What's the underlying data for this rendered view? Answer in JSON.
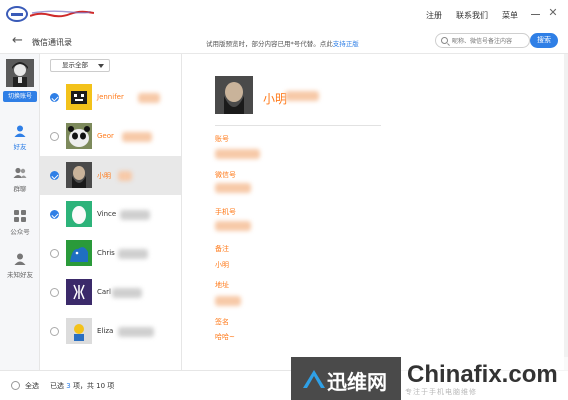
{
  "titlebar": {
    "links": [
      "注册",
      "联系我们",
      "菜单"
    ],
    "minimize_icon": "minimize-icon",
    "close_glyph": "✕"
  },
  "subheader": {
    "back_glyph": "←",
    "title": "微信通讯录",
    "notice_text": "试用版预览时，部分内容已用*号代替。点此",
    "notice_link": "支持正版",
    "search_placeholder": "昵称、微信号备注内容",
    "search_button": "搜索"
  },
  "leftnav": {
    "switch_account": "切换账号",
    "items": [
      {
        "label": "好友",
        "icon": "person-icon",
        "active": true
      },
      {
        "label": "群聊",
        "icon": "group-icon",
        "active": false
      },
      {
        "label": "公众号",
        "icon": "grid-icon",
        "active": false
      },
      {
        "label": "未知好友",
        "icon": "unknown-person-icon",
        "active": false
      }
    ]
  },
  "list": {
    "filter_label": "显示全部",
    "rows": [
      {
        "name": "Jennifer",
        "checked": true,
        "highlight": true,
        "selected": false
      },
      {
        "name": "Geor",
        "checked": false,
        "highlight": true,
        "selected": false
      },
      {
        "name": "小明",
        "checked": true,
        "highlight": true,
        "selected": true
      },
      {
        "name": "Vince",
        "checked": true,
        "highlight": false,
        "selected": false
      },
      {
        "name": "Chris",
        "checked": false,
        "highlight": false,
        "selected": false
      },
      {
        "name": "Carl",
        "checked": false,
        "highlight": false,
        "selected": false
      },
      {
        "name": "Eliza",
        "checked": false,
        "highlight": false,
        "selected": false
      }
    ]
  },
  "detail": {
    "name": "小明",
    "fields": [
      {
        "label": "账号",
        "value": ""
      },
      {
        "label": "微信号",
        "value": ""
      },
      {
        "label": "手机号",
        "value": ""
      },
      {
        "label": "备注",
        "value": "小明"
      },
      {
        "label": "地址",
        "value": ""
      },
      {
        "label": "签名",
        "value": "哈哈~"
      }
    ]
  },
  "footer": {
    "select_all": "全选",
    "count_prefix": "已选",
    "selected_count": "3",
    "count_suffix": "项，共 10 项"
  },
  "watermark": {
    "cn": "迅维网",
    "en": "Chinafix.com",
    "sub": "专注于手机电脑维修"
  },
  "colors": {
    "accent_blue": "#2f7fe6",
    "highlight_orange": "#ff7a1a"
  }
}
